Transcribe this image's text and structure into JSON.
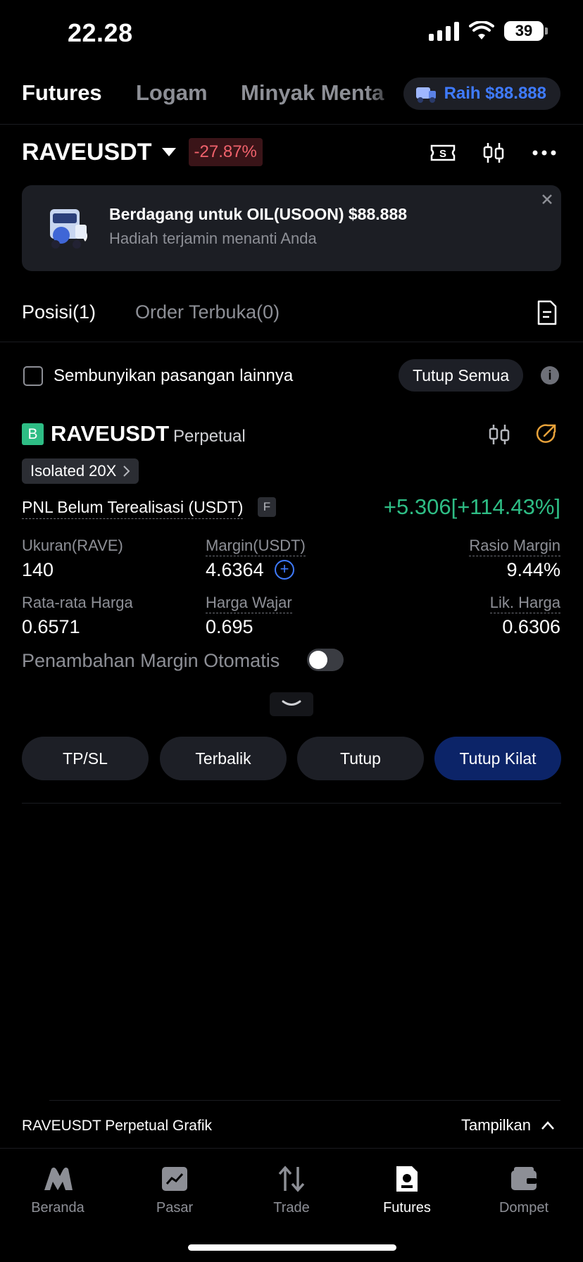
{
  "status_bar": {
    "time": "22.28",
    "battery": "39"
  },
  "top_tabs": {
    "items": [
      "Futures",
      "Logam",
      "Minyak Menta"
    ],
    "promo": "Raih $88.888"
  },
  "pair": {
    "name": "RAVEUSDT",
    "change": "-27.87%"
  },
  "banner": {
    "title": "Berdagang untuk OIL(USOON) $88.888",
    "subtitle": "Hadiah terjamin menanti Anda"
  },
  "pos_tabs": {
    "positions": "Posisi(1)",
    "open_orders": "Order Terbuka(0)"
  },
  "filter": {
    "hide_label": "Sembunyikan pasangan lainnya",
    "close_all": "Tutup Semua"
  },
  "position": {
    "side_badge": "B",
    "symbol": "RAVEUSDT",
    "type": "Perpetual",
    "mode": "Isolated 20X",
    "pnl_label": "PNL Belum Terealisasi (USDT)",
    "pnl_badge": "F",
    "pnl_value": "+5.306[+114.43%]",
    "size_label": "Ukuran(RAVE)",
    "size": "140",
    "margin_label": "Margin(USDT)",
    "margin": "4.6364",
    "ratio_label": "Rasio Margin",
    "ratio": "9.44%",
    "avg_label": "Rata-rata Harga",
    "avg": "0.6571",
    "fair_label": "Harga Wajar",
    "fair": "0.695",
    "liq_label": "Lik. Harga",
    "liq": "0.6306",
    "auto_margin_label": "Penambahan Margin Otomatis",
    "auto_margin_on": false
  },
  "actions": [
    "TP/SL",
    "Terbalik",
    "Tutup",
    "Tutup Kilat"
  ],
  "chart_footer": {
    "label": "RAVEUSDT Perpetual Grafik",
    "toggle": "Tampilkan"
  },
  "nav": [
    "Beranda",
    "Pasar",
    "Trade",
    "Futures",
    "Dompet"
  ],
  "colors": {
    "accent_blue": "#3f7bff",
    "positive": "#2ebd85",
    "negative": "#f0626c",
    "primary_button": "#0c2468"
  }
}
